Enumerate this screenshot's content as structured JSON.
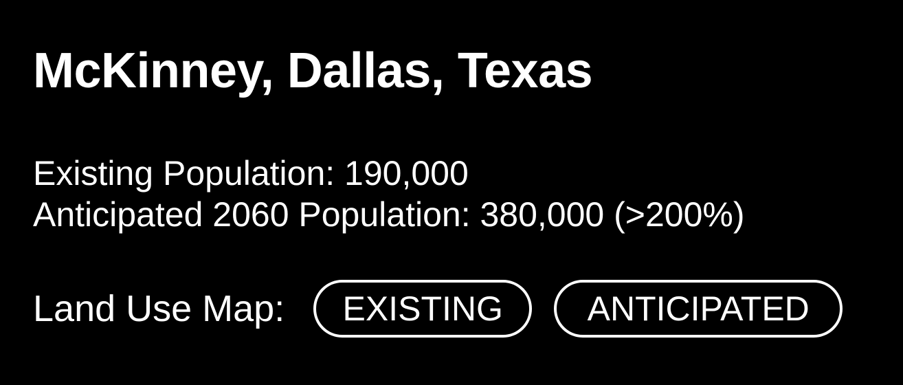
{
  "header": {
    "title": "McKinney, Dallas, Texas"
  },
  "stats": {
    "existing_population": "Existing Population: 190,000",
    "anticipated_population": "Anticipated 2060 Population: 380,000 (>200%)"
  },
  "land_use_map": {
    "label": "Land Use Map:",
    "options": [
      "EXISTING",
      "ANTICIPATED"
    ]
  },
  "colors": {
    "background": "#000000",
    "text": "#ffffff"
  }
}
